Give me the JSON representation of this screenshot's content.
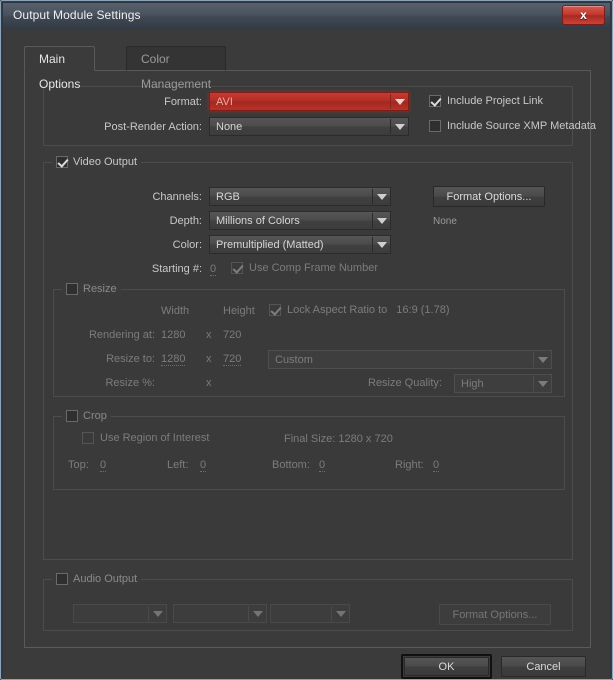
{
  "window": {
    "title": "Output Module Settings",
    "close_label": "x"
  },
  "tabs": [
    {
      "label": "Main Options",
      "active": true
    },
    {
      "label": "Color Management",
      "active": false
    }
  ],
  "format_group": {
    "format_label": "Format:",
    "format_value": "AVI",
    "post_render_label": "Post-Render Action:",
    "post_render_value": "None",
    "include_project_link": "Include Project Link",
    "include_xmp": "Include Source XMP Metadata"
  },
  "video_output": {
    "group_label": "Video Output",
    "channels_label": "Channels:",
    "channels_value": "RGB",
    "depth_label": "Depth:",
    "depth_value": "Millions of Colors",
    "color_label": "Color:",
    "color_value": "Premultiplied (Matted)",
    "starting_num_label": "Starting #:",
    "starting_num_value": "0",
    "use_comp_frame_number": "Use Comp Frame Number",
    "format_options_button": "Format Options...",
    "format_options_status": "None"
  },
  "resize": {
    "group_label": "Resize",
    "width_header": "Width",
    "height_header": "Height",
    "lock_aspect_label": "Lock Aspect Ratio to",
    "lock_aspect_value": "16:9 (1.78)",
    "rendering_at_label": "Rendering at:",
    "rendering_width": "1280",
    "rendering_x": "x",
    "rendering_height": "720",
    "resize_to_label": "Resize to:",
    "resize_width": "1280",
    "resize_x": "x",
    "resize_height": "720",
    "preset_value": "Custom",
    "resize_pct_label": "Resize %:",
    "resize_pct_x": "x",
    "quality_label": "Resize Quality:",
    "quality_value": "High"
  },
  "crop": {
    "group_label": "Crop",
    "use_roi_label": "Use Region of Interest",
    "final_size_label": "Final Size: 1280 x 720",
    "top_label": "Top:",
    "top_value": "0",
    "left_label": "Left:",
    "left_value": "0",
    "bottom_label": "Bottom:",
    "bottom_value": "0",
    "right_label": "Right:",
    "right_value": "0"
  },
  "audio_output": {
    "group_label": "Audio Output",
    "rate_value": "",
    "depth_value": "",
    "channels_value": "",
    "format_options_button": "Format Options..."
  },
  "footer": {
    "ok_label": "OK",
    "cancel_label": "Cancel"
  },
  "colors": {
    "accent_red": "#b02e26",
    "window_bg": "#3b3b3b",
    "titlebar_top": "#57606b",
    "text": "#c8c8c8",
    "text_disabled": "#7c7c7c",
    "border": "#4c4c4c"
  }
}
